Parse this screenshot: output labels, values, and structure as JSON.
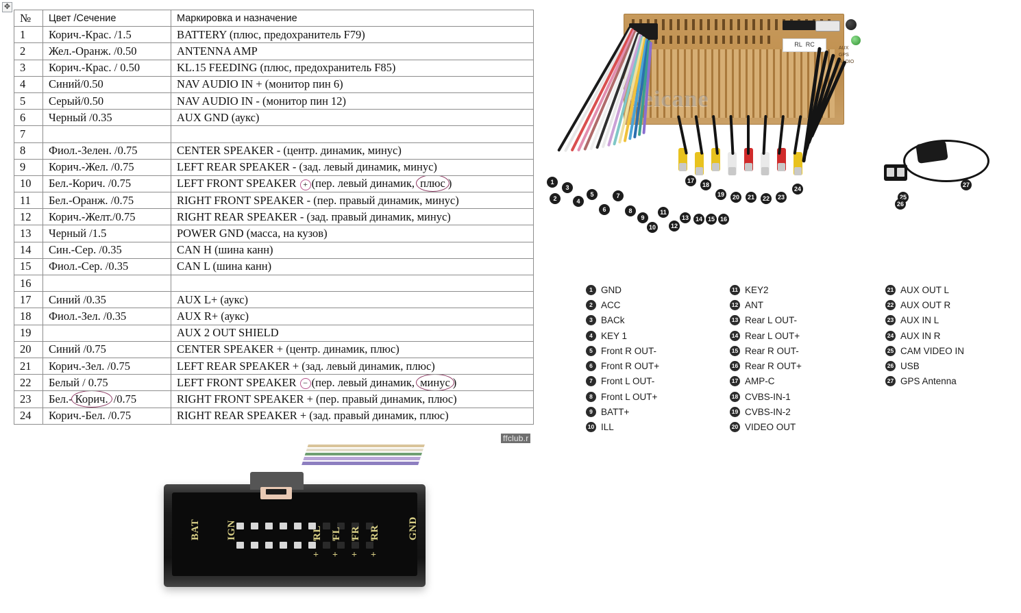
{
  "table": {
    "move_handle_icon": "move-cross-icon",
    "headers": [
      "№",
      "Цвет /Сечение",
      "Маркировка и назначение"
    ],
    "rows": [
      {
        "num": "1",
        "color": "Корич.-Крас. /1.5",
        "desc": "BATTERY (плюс, предохранитель F79)"
      },
      {
        "num": "2",
        "color": "Жел.-Оранж. /0.50",
        "desc": "ANTENNA AMP"
      },
      {
        "num": "3",
        "color": "Корич.-Крас. / 0.50",
        "desc": "KL.15 FEEDING (плюс, предохранитель F85)"
      },
      {
        "num": "4",
        "color": "Синий/0.50",
        "desc": "NAV AUDIO IN + (монитор пин 6)"
      },
      {
        "num": "5",
        "color": "Серый/0.50",
        "desc": "NAV AUDIO IN - (монитор пин 12)"
      },
      {
        "num": "6",
        "color": "Черный /0.35",
        "desc": "AUX GND (аукс)"
      },
      {
        "num": "7",
        "color": "",
        "desc": ""
      },
      {
        "num": "8",
        "color": "Фиол.-Зелен. /0.75",
        "desc": "CENTER SPEAKER - (центр. динамик, минус)"
      },
      {
        "num": "9",
        "color": "Корич.-Жел. /0.75",
        "desc": "LEFT REAR SPEAKER - (зад. левый динамик, минус)"
      },
      {
        "num": "10",
        "color": "Бел.-Корич. /0.75",
        "desc": "LEFT FRONT SPEAKER",
        "desc_sym": "⊕",
        "desc2": "(пер. левый динамик,",
        "desc_circled": "плюс",
        "desc_tail": ")"
      },
      {
        "num": "11",
        "color": "Бел.-Оранж. /0.75",
        "desc": "RIGHT FRONT SPEAKER - (пер. правый динамик, минус)"
      },
      {
        "num": "12",
        "color": "Корич.-Желт./0.75",
        "desc": "RIGHT REAR SPEAKER - (зад. правый динамик, минус)"
      },
      {
        "num": "13",
        "color": "Черный /1.5",
        "desc": "POWER GND (масса, на кузов)"
      },
      {
        "num": "14",
        "color": "Син.-Сер. /0.35",
        "desc": "CAN H (шина канн)"
      },
      {
        "num": "15",
        "color": "Фиол.-Сер. /0.35",
        "desc": "CAN L (шина канн)"
      },
      {
        "num": "16",
        "color": "",
        "desc": ""
      },
      {
        "num": "17",
        "color": "Синий /0.35",
        "desc": "AUX L+ (аукс)"
      },
      {
        "num": "18",
        "color": "Фиол.-Зел. /0.35",
        "desc": "AUX R+ (аукс)"
      },
      {
        "num": "19",
        "color": "",
        "desc": "AUX 2 OUT SHIELD"
      },
      {
        "num": "20",
        "color": "Синий /0.75",
        "desc": "CENTER SPEAKER + (центр. динамик, плюс)"
      },
      {
        "num": "21",
        "color": "Корич.-Зел. /0.75",
        "desc": "LEFT REAR SPEAKER + (зад. левый динамик, плюс)"
      },
      {
        "num": "22",
        "color": "Белый / 0.75",
        "desc": "LEFT FRONT SPEAKER",
        "desc_sym": "⊖",
        "desc2": "(пер. левый динамик,",
        "desc_circled": "минус",
        "desc_tail": ")"
      },
      {
        "num": "23",
        "color_pre": "Бел.-",
        "color_circled": "Корич.",
        "color_post": "/0.75",
        "color": "Бел.-Корич. /0.75",
        "desc": "RIGHT FRONT SPEAKER + (пер. правый динамик, плюс)"
      },
      {
        "num": "24",
        "color": "Корич.-Бел. /0.75",
        "desc": "RIGHT REAR SPEAKER + (зад. правый динамик, плюс)"
      }
    ]
  },
  "watermarks": {
    "table_bottom": "ffclub.r",
    "photo": "Seicane"
  },
  "photo": {
    "name": "car-head-unit-rear-with-harness",
    "unit_port_labels": [
      "RL",
      "RC",
      "AUX",
      "GPS",
      "RADIO"
    ],
    "callouts": [
      "1",
      "2",
      "3",
      "4",
      "5",
      "6",
      "7",
      "8",
      "9",
      "10",
      "11",
      "12",
      "13",
      "14",
      "15",
      "16",
      "17",
      "18",
      "19",
      "20",
      "21",
      "22",
      "23",
      "24",
      "25",
      "26",
      "27"
    ]
  },
  "legend": {
    "columns": [
      [
        {
          "n": "1",
          "label": "GND"
        },
        {
          "n": "2",
          "label": "ACC"
        },
        {
          "n": "3",
          "label": "BACk"
        },
        {
          "n": "4",
          "label": "KEY 1"
        },
        {
          "n": "5",
          "label": "Front R OUT-"
        },
        {
          "n": "6",
          "label": "Front R OUT+"
        },
        {
          "n": "7",
          "label": "Front L OUT-"
        },
        {
          "n": "8",
          "label": "Front L OUT+"
        },
        {
          "n": "9",
          "label": "BATT+"
        },
        {
          "n": "10",
          "label": "ILL"
        }
      ],
      [
        {
          "n": "11",
          "label": "KEY2"
        },
        {
          "n": "12",
          "label": "ANT"
        },
        {
          "n": "13",
          "label": "Rear L OUT-"
        },
        {
          "n": "14",
          "label": "Rear L OUT+"
        },
        {
          "n": "15",
          "label": "Rear R OUT-"
        },
        {
          "n": "16",
          "label": "Rear R OUT+"
        },
        {
          "n": "17",
          "label": "AMP-C"
        },
        {
          "n": "18",
          "label": "CVBS-IN-1"
        },
        {
          "n": "19",
          "label": "CVBS-IN-2"
        },
        {
          "n": "20",
          "label": "VIDEO OUT"
        }
      ],
      [
        {
          "n": "21",
          "label": "AUX OUT L"
        },
        {
          "n": "22",
          "label": "AUX OUT R"
        },
        {
          "n": "23",
          "label": "AUX IN L"
        },
        {
          "n": "24",
          "label": "AUX IN R"
        },
        {
          "n": "25",
          "label": "CAM VIDEO IN"
        },
        {
          "n": "26",
          "label": "USB"
        },
        {
          "n": "27",
          "label": "GPS Antenna"
        }
      ]
    ]
  },
  "connector": {
    "name": "iso-connector-pinout-photo",
    "labels": [
      "BAT",
      "IGN",
      "RL",
      "FL",
      "FR",
      "RR",
      "GND"
    ],
    "polarity_top": [
      "-",
      "-",
      "-",
      "-"
    ],
    "polarity_bottom": [
      "+",
      "+",
      "+",
      "+"
    ]
  },
  "colors": {
    "table_border": "#8d8d8d",
    "annotation_circle": "#8d3a63",
    "callout_bg": "#1d1d1d",
    "unit_body": "#c08f4e"
  }
}
